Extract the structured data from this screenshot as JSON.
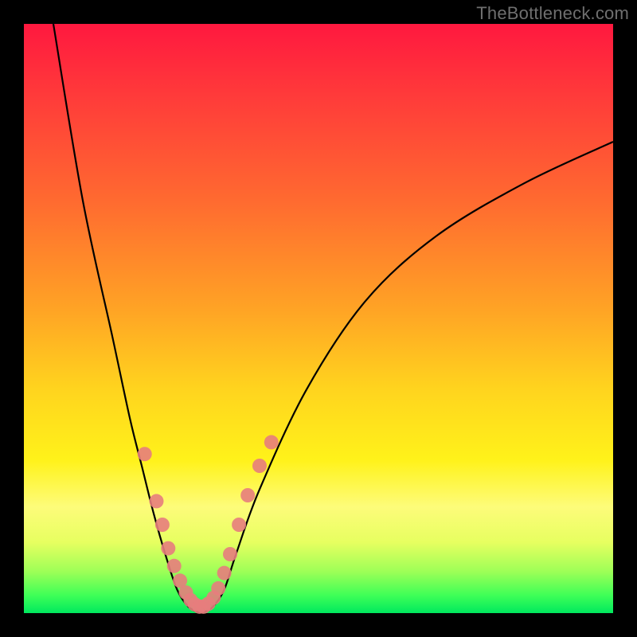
{
  "watermark": "TheBottleneck.com",
  "chart_data": {
    "type": "line",
    "title": "",
    "xlabel": "",
    "ylabel": "",
    "xlim": [
      0,
      100
    ],
    "ylim": [
      0,
      100
    ],
    "gradient_bands": [
      {
        "name": "red",
        "y_pct": 0
      },
      {
        "name": "orange",
        "y_pct": 45
      },
      {
        "name": "yellow",
        "y_pct": 75
      },
      {
        "name": "green",
        "y_pct": 100
      }
    ],
    "series": [
      {
        "name": "left-branch",
        "type": "curve",
        "points": [
          {
            "x": 5,
            "y": 100
          },
          {
            "x": 10,
            "y": 70
          },
          {
            "x": 15,
            "y": 47
          },
          {
            "x": 18,
            "y": 33
          },
          {
            "x": 20,
            "y": 25
          },
          {
            "x": 22,
            "y": 17
          },
          {
            "x": 24,
            "y": 10
          },
          {
            "x": 26,
            "y": 4
          },
          {
            "x": 28,
            "y": 1
          },
          {
            "x": 30,
            "y": 0
          }
        ]
      },
      {
        "name": "right-branch",
        "type": "curve",
        "points": [
          {
            "x": 30,
            "y": 0
          },
          {
            "x": 32,
            "y": 1
          },
          {
            "x": 34,
            "y": 4
          },
          {
            "x": 36,
            "y": 10
          },
          {
            "x": 40,
            "y": 21
          },
          {
            "x": 48,
            "y": 38
          },
          {
            "x": 58,
            "y": 53
          },
          {
            "x": 70,
            "y": 64
          },
          {
            "x": 85,
            "y": 73
          },
          {
            "x": 100,
            "y": 80
          }
        ]
      },
      {
        "name": "markers",
        "type": "scatter",
        "points": [
          {
            "x": 20.5,
            "y": 27
          },
          {
            "x": 22.5,
            "y": 19
          },
          {
            "x": 23.5,
            "y": 15
          },
          {
            "x": 24.5,
            "y": 11
          },
          {
            "x": 25.5,
            "y": 8
          },
          {
            "x": 26.5,
            "y": 5.5
          },
          {
            "x": 27.5,
            "y": 3.5
          },
          {
            "x": 28.3,
            "y": 2.2
          },
          {
            "x": 29.0,
            "y": 1.5
          },
          {
            "x": 29.8,
            "y": 1.1
          },
          {
            "x": 30.5,
            "y": 1.1
          },
          {
            "x": 31.3,
            "y": 1.6
          },
          {
            "x": 32.2,
            "y": 2.6
          },
          {
            "x": 33.0,
            "y": 4.2
          },
          {
            "x": 34.0,
            "y": 6.8
          },
          {
            "x": 35.0,
            "y": 10
          },
          {
            "x": 36.5,
            "y": 15
          },
          {
            "x": 38.0,
            "y": 20
          },
          {
            "x": 40.0,
            "y": 25
          },
          {
            "x": 42.0,
            "y": 29
          }
        ]
      }
    ]
  }
}
